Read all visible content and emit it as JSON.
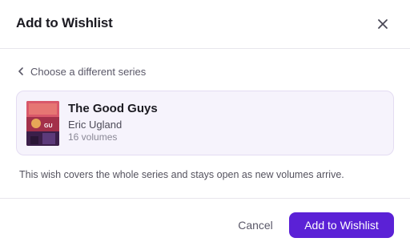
{
  "dialog": {
    "title": "Add to Wishlist"
  },
  "back_link": {
    "label": "Choose a different series"
  },
  "series": {
    "title": "The Good Guys",
    "author": "Eric Ugland",
    "volumes": "16 volumes",
    "cover_text": "GU"
  },
  "note": "This wish covers the whole series and stays open as new volumes arrive.",
  "footer": {
    "cancel_label": "Cancel",
    "confirm_label": "Add to Wishlist"
  },
  "colors": {
    "accent": "#5b21d6",
    "card_background": "#f6f3fc",
    "card_border": "#e4dcf2"
  },
  "icons": {
    "close": "close-icon",
    "back": "chevron-left-icon"
  }
}
